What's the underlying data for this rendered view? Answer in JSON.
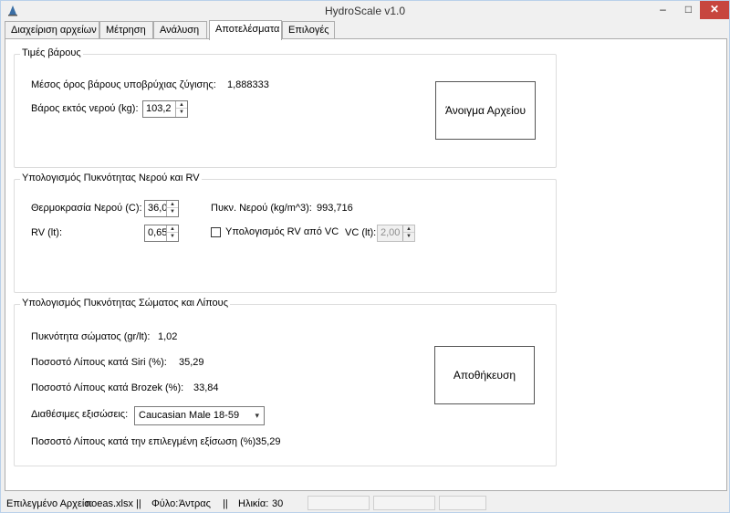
{
  "window": {
    "title": "HydroScale v1.0",
    "minimize": "–",
    "maximize": "□",
    "close": "✕"
  },
  "tabs": [
    {
      "label": "Διαχείριση αρχείων"
    },
    {
      "label": "Μέτρηση"
    },
    {
      "label": "Ανάλυση"
    },
    {
      "label": "Αποτελέσματα",
      "active": true
    },
    {
      "label": "Επιλογές"
    }
  ],
  "weights": {
    "title": "Τιμές βάρους",
    "mean_label": "Μέσος όρος βάρους υποβρύχιας ζύγισης:",
    "mean_value": "1,888333",
    "dry_label": "Βάρος εκτός νερού (kg):",
    "dry_value": "103,2",
    "open_file_button": "Άνοιγμα Αρχείου"
  },
  "water": {
    "title": "Υπολογισμός Πυκνότητας Νερού και RV",
    "temp_label": "Θερμοκρασία Νερού (C):",
    "temp_value": "36,0",
    "density_label": "Πυκν. Νερού (kg/m^3):",
    "density_value": "993,716",
    "rv_label": "RV (lt):",
    "rv_value": "0,65",
    "rv_checkbox_label": "Υπολογισμός RV από VC",
    "rv_checkbox_checked": false,
    "vc_label": "VC (lt):",
    "vc_value": "2,00"
  },
  "body": {
    "title": "Υπολογισμός Πυκνότητας Σώματος και Λίπους",
    "density_label": "Πυκνότητα σώματος (gr/lt):",
    "density_value": "1,02",
    "siri_label": "Ποσοστό Λίπους κατά Siri (%):",
    "siri_value": "35,29",
    "brozek_label": "Ποσοστό Λίπους κατά Brozek (%):",
    "brozek_value": "33,84",
    "equations_label": "Διαθέσιμες εξισώσεις:",
    "equations_selected": "Caucasian Male 18-59",
    "selected_label": "Ποσοστό Λίπους κατά την επιλεγμένη εξίσωση (%):",
    "selected_value": "35,29",
    "save_button": "Αποθήκευση"
  },
  "status": {
    "file_label": "Επιλεγμένο Αρχείο:",
    "file_value": "noeas.xlsx",
    "sep": "||",
    "sex_label": "Φύλο:",
    "sex_value": "Άντρας",
    "age_label": "Ηλικία:",
    "age_value": "30"
  },
  "colors": {
    "close_button": "#c7463e",
    "tab_page": "#ffffff",
    "window_bg": "#f0f0f0"
  }
}
